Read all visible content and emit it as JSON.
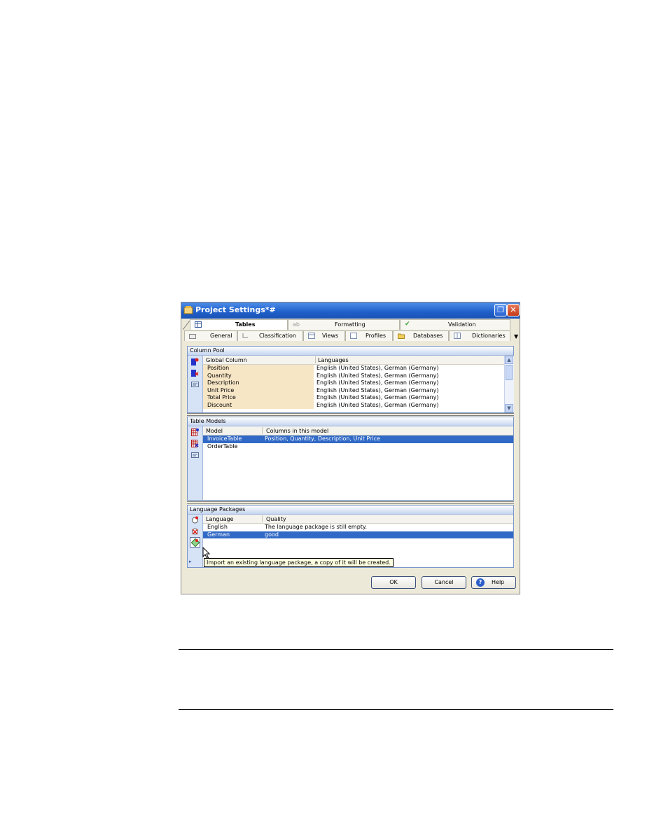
{
  "window": {
    "title": "Project Settings*#"
  },
  "tabs_row1": [
    {
      "label": "Tables",
      "icon": "table-icon",
      "selected": true
    },
    {
      "label": "Formatting",
      "icon": "formatting-icon",
      "selected": false
    },
    {
      "label": "Validation",
      "icon": "checkmark-icon",
      "selected": false
    }
  ],
  "tabs_row2": [
    {
      "label": "General",
      "icon": "general-icon"
    },
    {
      "label": "Classification",
      "icon": "classification-icon"
    },
    {
      "label": "Views",
      "icon": "views-icon"
    },
    {
      "label": "Profiles",
      "icon": "profiles-icon"
    },
    {
      "label": "Databases",
      "icon": "folder-icon"
    },
    {
      "label": "Dictionaries",
      "icon": "dictionary-icon"
    }
  ],
  "column_pool": {
    "title": "Column Pool",
    "headers": [
      "Global Column",
      "Languages"
    ],
    "rows": [
      [
        "Position",
        "English (United States), German (Germany)"
      ],
      [
        "Quantity",
        "English (United States), German (Germany)"
      ],
      [
        "Description",
        "English (United States), German (Germany)"
      ],
      [
        "Unit Price",
        "English (United States), German (Germany)"
      ],
      [
        "Total Price",
        "English (United States), German (Germany)"
      ],
      [
        "Discount",
        "English (United States), German (Germany)"
      ]
    ]
  },
  "table_models": {
    "title": "Table Models",
    "headers": [
      "Model",
      "Columns in this model"
    ],
    "rows": [
      [
        "InvoiceTable",
        "Position, Quantity, Description, Unit Price"
      ],
      [
        "OrderTable",
        ""
      ]
    ]
  },
  "language_packages": {
    "title": "Language Packages",
    "headers": [
      "Language",
      "Quality"
    ],
    "rows": [
      [
        "English",
        "The language package is still empty."
      ],
      [
        "German",
        "good"
      ]
    ]
  },
  "tooltip": "Import an existing language package, a copy of it will be created.",
  "buttons": {
    "ok": "OK",
    "cancel": "Cancel",
    "help": "Help"
  },
  "colors": {
    "titlebar": "#1f5fc9",
    "selection": "#3169c6",
    "pool_highlight": "#f7e6c6"
  }
}
